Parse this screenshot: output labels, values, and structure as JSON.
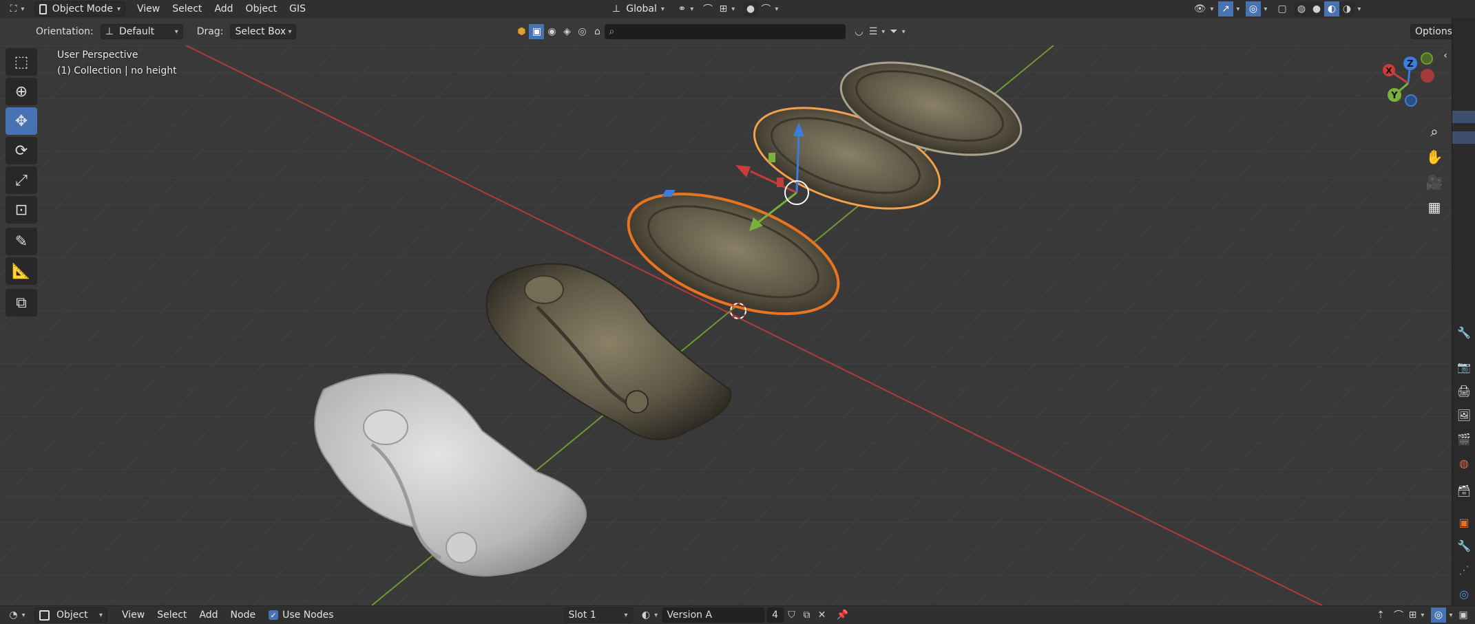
{
  "header": {
    "mode": "Object Mode",
    "menus": [
      "View",
      "Select",
      "Add",
      "Object",
      "GIS"
    ],
    "transform_orientation": "Global"
  },
  "tool_header": {
    "orientation_label": "Orientation:",
    "orientation_value": "Default",
    "drag_label": "Drag:",
    "drag_value": "Select Box",
    "options_label": "Options"
  },
  "viewport": {
    "perspective": "User Perspective",
    "collection_info": "(1) Collection | no height",
    "gizmo_axes": [
      "X",
      "Y",
      "Z"
    ]
  },
  "toolbox": {
    "tools": [
      "select-box",
      "cursor",
      "move",
      "rotate",
      "scale",
      "transform",
      "annotate",
      "measure",
      "add-cube"
    ],
    "active_tool": "move"
  },
  "bottom_bar": {
    "editor_mode": "Object",
    "menus": [
      "View",
      "Select",
      "Add",
      "Node"
    ],
    "use_nodes_label": "Use Nodes",
    "use_nodes_checked": true,
    "slot": "Slot 1",
    "material_name": "Version A",
    "user_count": "4"
  },
  "colors": {
    "accent": "#4772b3",
    "x_axis": "#c83c3c",
    "y_axis": "#7ab03c",
    "z_axis": "#3b7ddd",
    "selection_outline": "#e8741f",
    "active_outline": "#f5a04a"
  }
}
